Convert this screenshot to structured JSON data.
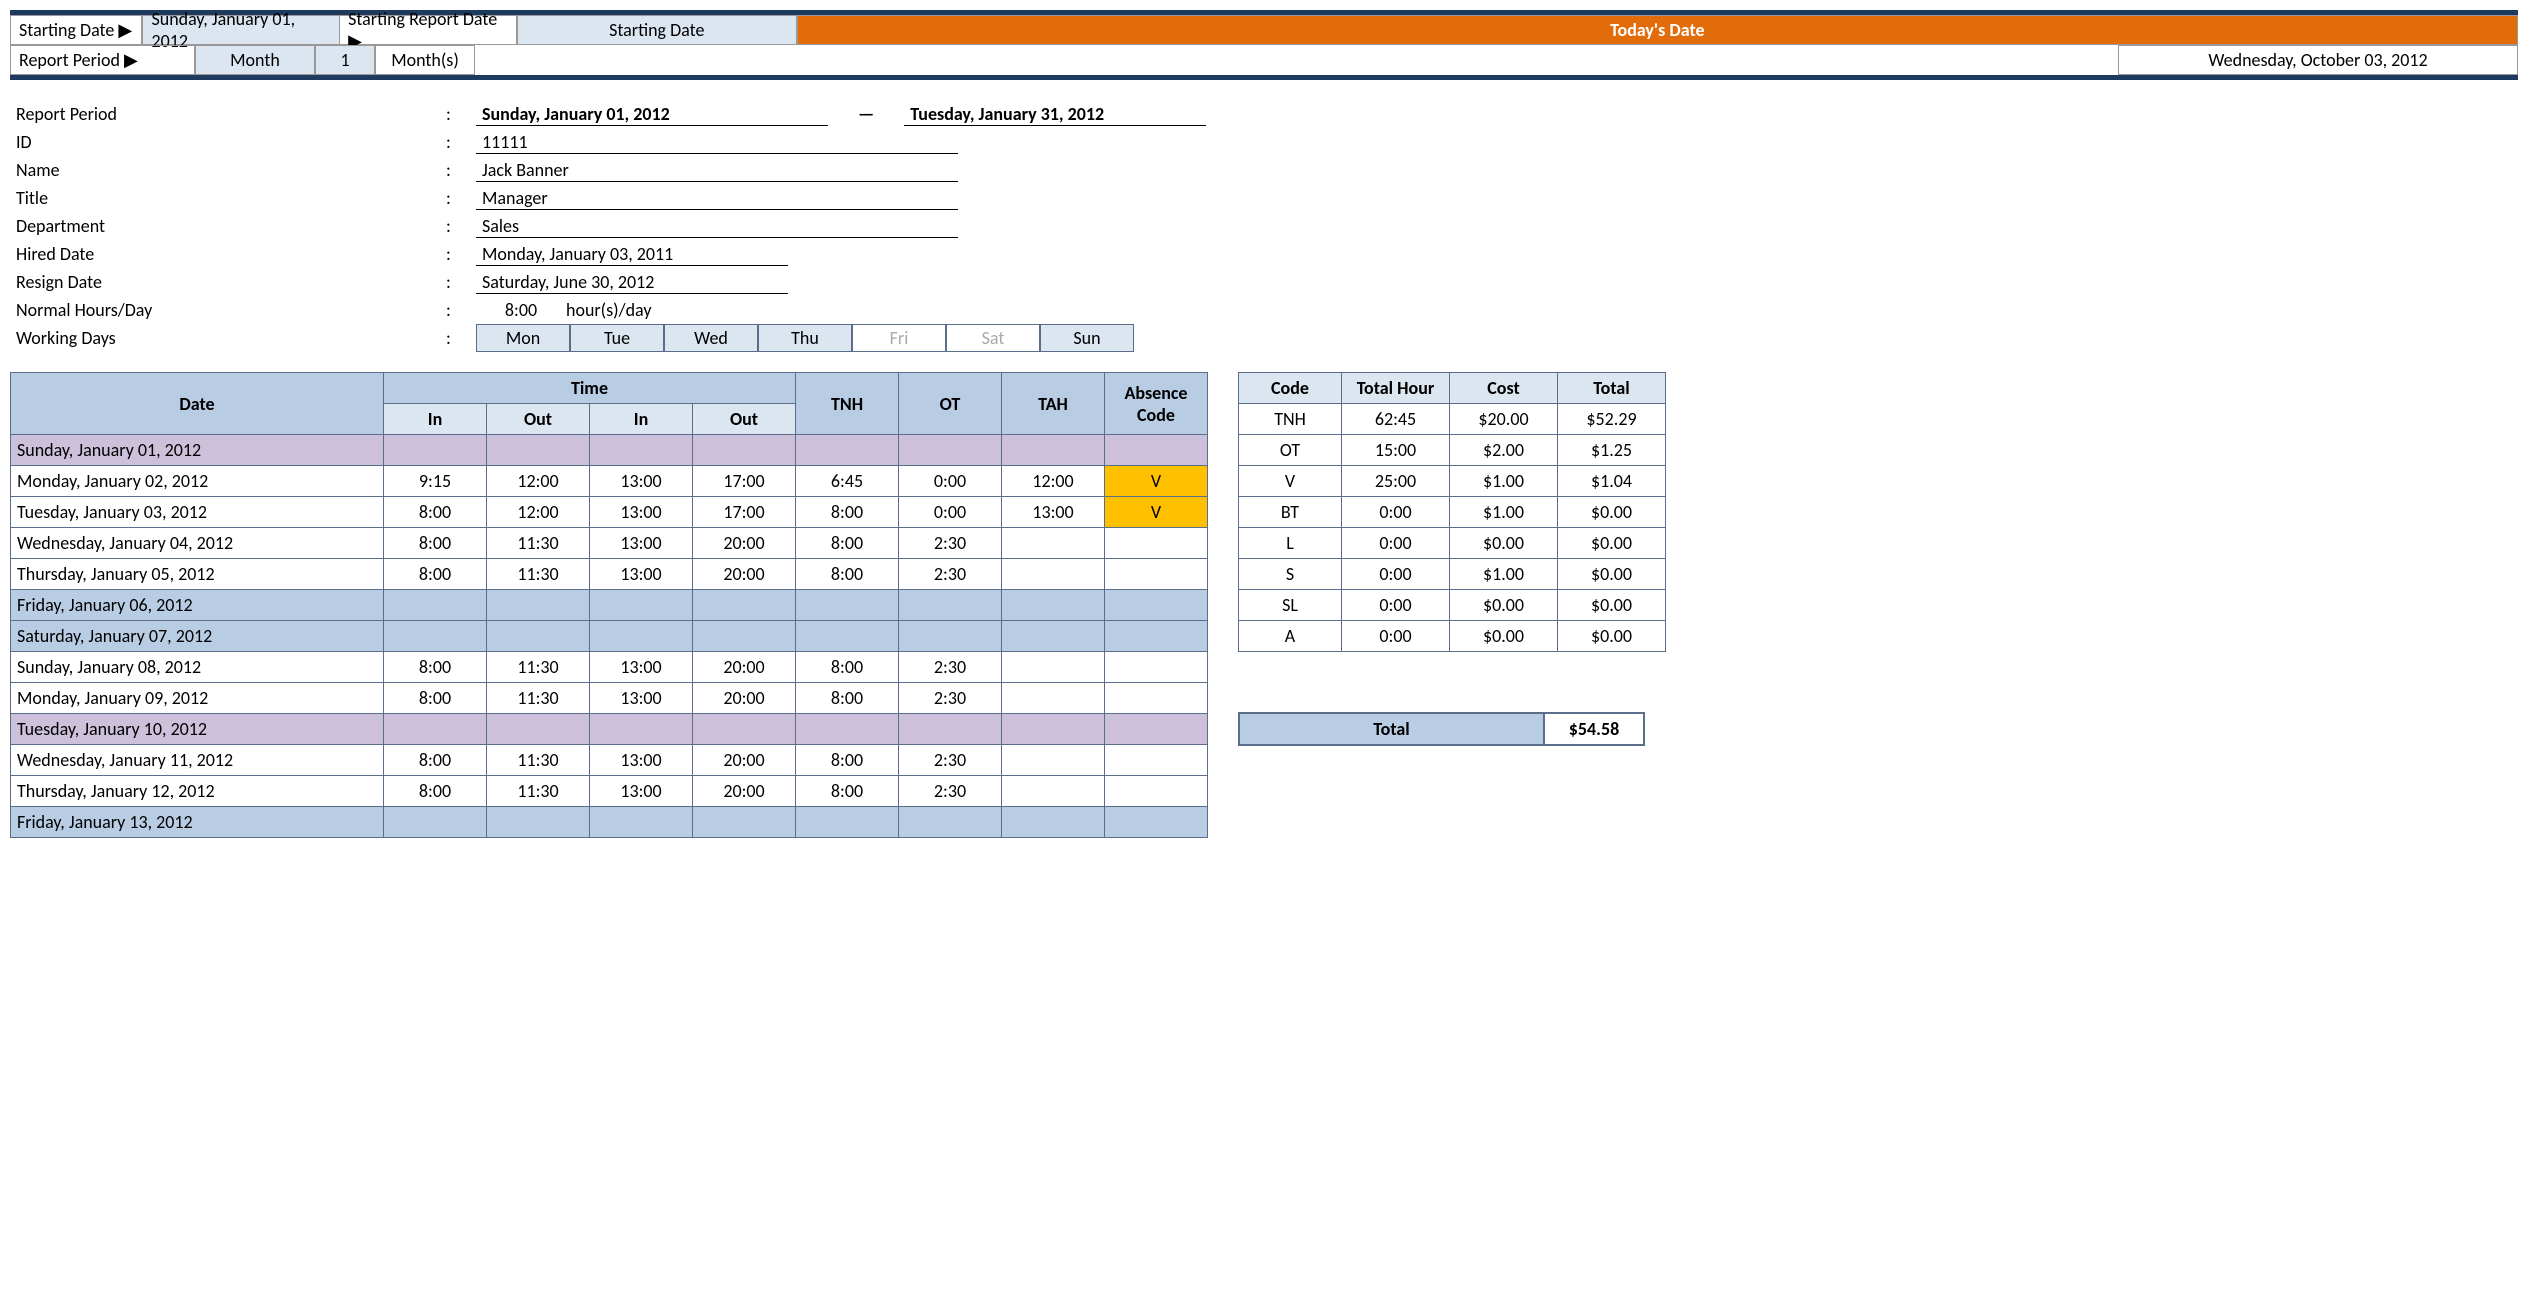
{
  "header": {
    "starting_date_label": "Starting Date ▶",
    "starting_date_value": "Sunday, January 01, 2012",
    "report_period_label": "Report Period ▶",
    "period_unit": "Month",
    "period_count": "1",
    "period_units": "Month(s)",
    "starting_report_label": "Starting Report Date ▶",
    "starting_report_value": "Starting Date",
    "today_label": "Today's Date",
    "today_value": "Wednesday, October 03, 2012"
  },
  "info": {
    "report_period_label": "Report Period",
    "report_start": "Sunday, January 01, 2012",
    "report_end": "Tuesday, January 31, 2012",
    "id_label": "ID",
    "id": "11111",
    "name_label": "Name",
    "name": "Jack Banner",
    "title_label": "Title",
    "title": "Manager",
    "dept_label": "Department",
    "dept": "Sales",
    "hired_label": "Hired Date",
    "hired": "Monday, January 03, 2011",
    "resign_label": "Resign Date",
    "resign": "Saturday, June 30, 2012",
    "hours_label": "Normal Hours/Day",
    "hours": "8:00",
    "hours_unit": "hour(s)/day",
    "working_label": "Working Days",
    "days": [
      "Mon",
      "Tue",
      "Wed",
      "Thu",
      "Fri",
      "Sat",
      "Sun"
    ],
    "days_off": [
      false,
      false,
      false,
      false,
      true,
      true,
      false
    ]
  },
  "table": {
    "h_date": "Date",
    "h_time": "Time",
    "h_in": "In",
    "h_out": "Out",
    "h_tnh": "TNH",
    "h_ot": "OT",
    "h_tah": "TAH",
    "h_absence": "Absence Code",
    "rows": [
      {
        "date": "Sunday, January 01, 2012",
        "cls": "row-purple"
      },
      {
        "date": "Monday, January 02, 2012",
        "in1": "9:15",
        "out1": "12:00",
        "in2": "13:00",
        "out2": "17:00",
        "tnh": "6:45",
        "ot": "0:00",
        "tah": "12:00",
        "abs": "V"
      },
      {
        "date": "Tuesday, January 03, 2012",
        "in1": "8:00",
        "out1": "12:00",
        "in2": "13:00",
        "out2": "17:00",
        "tnh": "8:00",
        "ot": "0:00",
        "tah": "13:00",
        "abs": "V"
      },
      {
        "date": "Wednesday, January 04, 2012",
        "in1": "8:00",
        "out1": "11:30",
        "in2": "13:00",
        "out2": "20:00",
        "tnh": "8:00",
        "ot": "2:30"
      },
      {
        "date": "Thursday, January 05, 2012",
        "in1": "8:00",
        "out1": "11:30",
        "in2": "13:00",
        "out2": "20:00",
        "tnh": "8:00",
        "ot": "2:30"
      },
      {
        "date": "Friday, January 06, 2012",
        "cls": "row-blue"
      },
      {
        "date": "Saturday, January 07, 2012",
        "cls": "row-blue"
      },
      {
        "date": "Sunday, January 08, 2012",
        "in1": "8:00",
        "out1": "11:30",
        "in2": "13:00",
        "out2": "20:00",
        "tnh": "8:00",
        "ot": "2:30"
      },
      {
        "date": "Monday, January 09, 2012",
        "in1": "8:00",
        "out1": "11:30",
        "in2": "13:00",
        "out2": "20:00",
        "tnh": "8:00",
        "ot": "2:30"
      },
      {
        "date": "Tuesday, January 10, 2012",
        "cls": "row-purple"
      },
      {
        "date": "Wednesday, January 11, 2012",
        "in1": "8:00",
        "out1": "11:30",
        "in2": "13:00",
        "out2": "20:00",
        "tnh": "8:00",
        "ot": "2:30"
      },
      {
        "date": "Thursday, January 12, 2012",
        "in1": "8:00",
        "out1": "11:30",
        "in2": "13:00",
        "out2": "20:00",
        "tnh": "8:00",
        "ot": "2:30"
      },
      {
        "date": "Friday, January 13, 2012",
        "cls": "row-blue"
      }
    ]
  },
  "summary": {
    "h_code": "Code",
    "h_hour": "Total Hour",
    "h_cost": "Cost",
    "h_total": "Total",
    "rows": [
      {
        "code": "TNH",
        "hour": "62:45",
        "cost": "$20.00",
        "total": "$52.29"
      },
      {
        "code": "OT",
        "hour": "15:00",
        "cost": "$2.00",
        "total": "$1.25"
      },
      {
        "code": "V",
        "hour": "25:00",
        "cost": "$1.00",
        "total": "$1.04"
      },
      {
        "code": "BT",
        "hour": "0:00",
        "cost": "$1.00",
        "total": "$0.00"
      },
      {
        "code": "L",
        "hour": "0:00",
        "cost": "$0.00",
        "total": "$0.00"
      },
      {
        "code": "S",
        "hour": "0:00",
        "cost": "$1.00",
        "total": "$0.00"
      },
      {
        "code": "SL",
        "hour": "0:00",
        "cost": "$0.00",
        "total": "$0.00"
      },
      {
        "code": "A",
        "hour": "0:00",
        "cost": "$0.00",
        "total": "$0.00"
      }
    ],
    "total_label": "Total",
    "total_value": "$54.58"
  }
}
